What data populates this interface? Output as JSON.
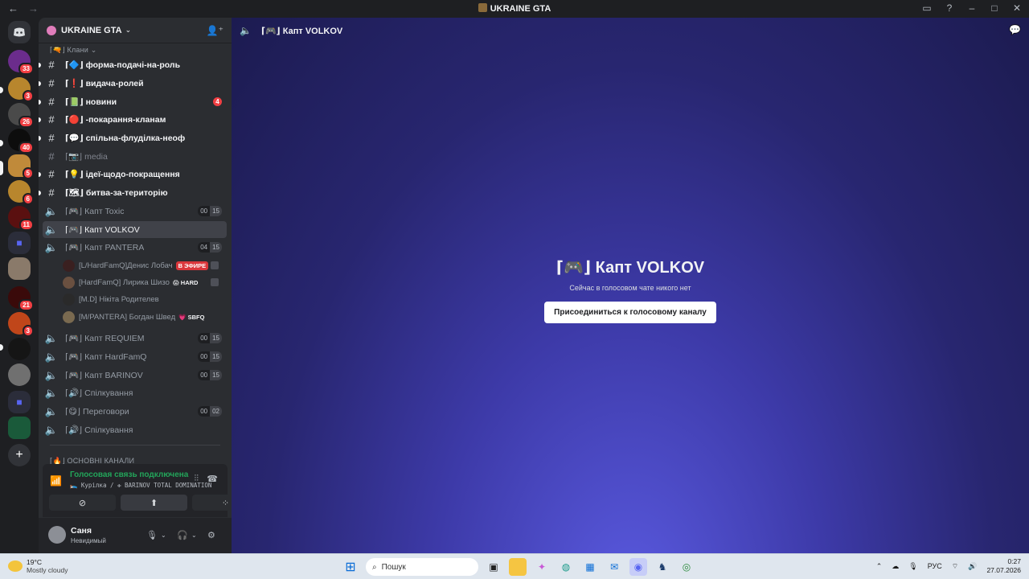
{
  "window": {
    "title": "UKRAINE GTA"
  },
  "guild": {
    "name": "UKRAINE GTA"
  },
  "categories": {
    "clans": "Клани",
    "main": "ОСНОВНІ КАНАЛИ"
  },
  "channels": [
    {
      "label": "⌈🔷⌋ форма-подачі-на-роль",
      "type": "text",
      "state": "unread"
    },
    {
      "label": "⌈❗⌋ видача-ролей",
      "type": "text",
      "state": "unread"
    },
    {
      "label": "⌈📗⌋ новини",
      "type": "text",
      "state": "unread",
      "mentions": "4"
    },
    {
      "label": "⌈🔴⌋ -покарання-кланам",
      "type": "text",
      "state": "unread"
    },
    {
      "label": "⌈💬⌋ спільна-флуділка-неоф",
      "type": "text",
      "state": "unread"
    },
    {
      "label": "⌈📷⌋ media",
      "type": "text",
      "state": "muted"
    },
    {
      "label": "⌈💡⌋ ідеї-щодо-покращення",
      "type": "text",
      "state": "unread"
    },
    {
      "label": "⌈🗺⌋ битва-за-територію",
      "type": "text",
      "state": "unread"
    },
    {
      "label": "⌈🎮⌋ Капт Toxic",
      "type": "voice",
      "count_a": "00",
      "count_b": "15"
    },
    {
      "label": "⌈🎮⌋ Капт VOLKOV",
      "type": "voice",
      "state": "selected"
    },
    {
      "label": "⌈🎮⌋ Капт PANTERA",
      "type": "voice",
      "count_a": "04",
      "count_b": "15"
    }
  ],
  "voice_users": [
    {
      "name": "[L/HardFamQ]Денис Лобач",
      "live": "В ЭФИРЕ"
    },
    {
      "name": "[HardFamQ] Лирика Шизо",
      "tag": "😱 HARD"
    },
    {
      "name": "[M.D] Нікіта Родителев"
    },
    {
      "name": "[M/PANTERA] Богдан Швед",
      "tag": "💗 SBFQ"
    }
  ],
  "channels2": [
    {
      "label": "⌈🎮⌋ Капт REQUIEM",
      "count_a": "00",
      "count_b": "15"
    },
    {
      "label": "⌈🎮⌋ Капт HardFamQ",
      "count_a": "00",
      "count_b": "15"
    },
    {
      "label": "⌈🎮⌋ Капт BARINOV",
      "count_a": "00",
      "count_b": "15"
    },
    {
      "label": "⌈🔊⌋ Спілкування"
    },
    {
      "label": "⌈😋⌋ Переговори",
      "count_a": "00",
      "count_b": "02"
    },
    {
      "label": "⌈🔊⌋ Спілкування"
    }
  ],
  "voice_panel": {
    "status": "Голосовая связь подключена",
    "location": "🛌 Курілка / ✙ BARINOV TOTAL DOMINATION"
  },
  "user": {
    "name": "Саня",
    "status": "Невидимый"
  },
  "main": {
    "header_title": "⌈🎮⌋ Капт VOLKOV",
    "big_title": "⌈🎮⌋ Капт VOLKOV",
    "empty_text": "Сейчас в голосовом чате никого нет",
    "join_button": "Присоединиться к голосовому каналу"
  },
  "rail_badges": [
    "33",
    "3",
    "26",
    "40",
    "5",
    "6",
    "11",
    "21",
    "3"
  ],
  "taskbar": {
    "temperature": "19°C",
    "weather": "Mostly cloudy",
    "search_placeholder": "Пошук",
    "lang": "РУС",
    "time": "0:27",
    "date": "27.07.2026"
  }
}
